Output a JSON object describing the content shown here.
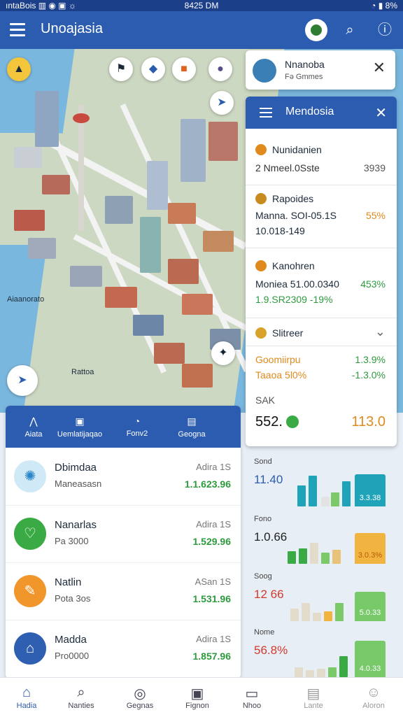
{
  "status": {
    "left": "ıntaBois ▥ ◉ ▣ ☼",
    "time": "8425 DM",
    "right": "◔ ▮ 8%"
  },
  "appbar": {
    "title": "Unoajasia",
    "search_icon": "search-icon",
    "info_icon": "info-icon"
  },
  "map": {
    "labels": {
      "west": "Aiaanorato",
      "south": "Rattoa"
    }
  },
  "location_card": {
    "title": "Nnanoba",
    "subtitle": "Fǝ Gmmes",
    "close": "✕"
  },
  "panel": {
    "title": "Mendosia",
    "close": "✕",
    "sections": [
      {
        "name": "Nunidanien",
        "row1_left": "2 Nmeel.0Sste",
        "row1_right": "3939",
        "icon_color": "#e08a1e"
      },
      {
        "name": "Rapoides",
        "row1_left": "Manna. SOI-05.1S",
        "row1_right": "55%",
        "row2_left": "10.018-149",
        "icon_color": "#c98a1e"
      },
      {
        "name": "Kanohren",
        "row1_left": "Moniea 51.00.0340",
        "row1_right": "453%",
        "row2_left": "1.9.SR2309 -19%",
        "icon_color": "#e08a1e"
      },
      {
        "name": "Slitreer",
        "chevron": "⌄",
        "icon_color": "#d9a32b"
      }
    ],
    "summary": {
      "row1_left": "Goomiirpu",
      "row1_right": "1.3.9%",
      "row2_left": "Taaoa 5l0%",
      "row2_right": "-1.3.0%",
      "label": "SAK",
      "value_left": "552.",
      "value_right": "113.0"
    },
    "charts": [
      {
        "label": "Sond",
        "value": "11.40",
        "big": "3.3.38",
        "color": "#1fa3b8"
      },
      {
        "label": "Fono",
        "value": "1.0.66",
        "big": "3.0.3%",
        "color": "#f2b441"
      },
      {
        "label": "Soog",
        "value": "12 66",
        "big": "5.0.33",
        "color": "#77c96a"
      },
      {
        "label": "Nome",
        "value": "56.8%",
        "big": "4.0.33",
        "color": "#77c96a"
      }
    ]
  },
  "stats": {
    "tabs": [
      "Aiata",
      "Uemlatijaqao",
      "Fonv2",
      "Geogna"
    ],
    "rows": [
      {
        "name": "Dbimdaa",
        "sub": "Maneasasn",
        "right_top": "Adira 1S",
        "right_val": "1.1.623.96",
        "color": "#4aa3d8"
      },
      {
        "name": "Nanarlas",
        "sub": "Pa 3000",
        "right_top": "Adira 1S",
        "right_val": "1.529.96",
        "color": "#3aaa44"
      },
      {
        "name": "Natlin",
        "sub": "Pota 3os",
        "right_top": "ASan 1S",
        "right_val": "1.531.96",
        "color": "#f0962a"
      },
      {
        "name": "Madda",
        "sub": "Pro0000",
        "right_top": "Adira 1S",
        "right_val": "1.857.96",
        "color": "#2f5fb0"
      }
    ]
  },
  "nav": [
    "Hadia",
    "Nanties",
    "Gegnas",
    "Fignon",
    "Nhoo",
    "Lante",
    "Aloron"
  ]
}
